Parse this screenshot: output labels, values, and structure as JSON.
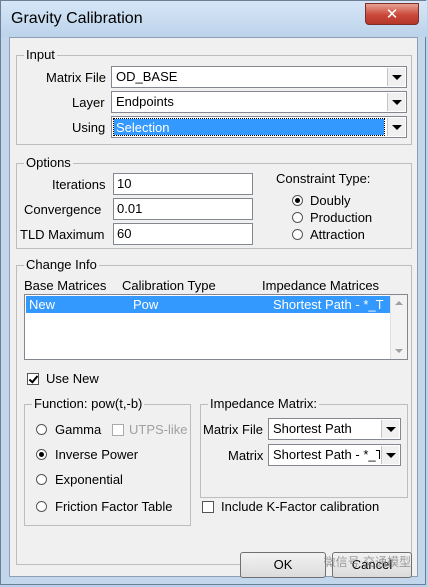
{
  "window": {
    "title": "Gravity Calibration",
    "close_glyph": "✕"
  },
  "input": {
    "title": "Input",
    "matrix_file_label": "Matrix File",
    "matrix_file_value": "OD_BASE",
    "layer_label": "Layer",
    "layer_value": "Endpoints",
    "using_label": "Using",
    "using_value": "Selection"
  },
  "options": {
    "title": "Options",
    "iterations_label": "Iterations",
    "iterations_value": "10",
    "convergence_label": "Convergence",
    "convergence_value": "0.01",
    "tld_label": "TLD Maximum",
    "tld_value": "60",
    "constraint_title": "Constraint Type:",
    "constraints": [
      "Doubly",
      "Production",
      "Attraction"
    ],
    "constraint_selected": "Doubly"
  },
  "change_info": {
    "title": "Change Info",
    "columns": [
      "Base Matrices",
      "Calibration Type",
      "Impedance Matrices"
    ],
    "rows": [
      {
        "base": "New",
        "type": "Pow",
        "impedance": "Shortest Path - *_T"
      }
    ],
    "use_new_label": "Use New",
    "use_new_checked": true
  },
  "function": {
    "title": "Function: pow(t,-b)",
    "options": [
      "Gamma",
      "Inverse Power",
      "Exponential",
      "Friction Factor Table"
    ],
    "selected": "Inverse Power",
    "utps_label": "UTPS-like"
  },
  "impedance": {
    "title": "Impedance Matrix:",
    "matrix_file_label": "Matrix File",
    "matrix_file_value": "Shortest Path",
    "matrix_label": "Matrix",
    "matrix_value": "Shortest Path - *_T"
  },
  "kfactor_label": "Include K-Factor calibration",
  "buttons": {
    "ok": "OK",
    "cancel": "Cancel"
  },
  "watermark": "微信号 交通模型"
}
